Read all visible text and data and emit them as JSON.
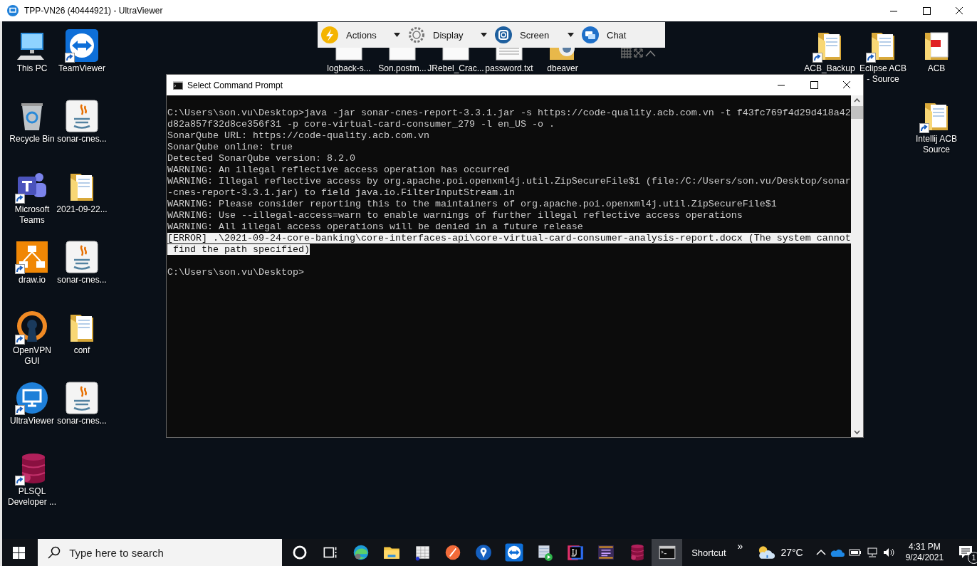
{
  "window": {
    "title": "TPP-VN26 (40444921) - UltraViewer"
  },
  "toolbar": {
    "items": [
      {
        "label": "Actions",
        "kind": "actions",
        "dropdown": true
      },
      {
        "label": "Display",
        "kind": "display",
        "dropdown": true
      },
      {
        "label": "Screen",
        "kind": "screen",
        "dropdown": true
      },
      {
        "label": "Chat",
        "kind": "chat",
        "dropdown": false
      }
    ]
  },
  "desktop": {
    "icons": [
      {
        "label": "This PC",
        "kind": "computer",
        "shortcut": false
      },
      {
        "label": "Recycle Bin",
        "kind": "recycle",
        "shortcut": false
      },
      {
        "label": "Microsoft Teams",
        "kind": "teams",
        "shortcut": true
      },
      {
        "label": "draw.io",
        "kind": "drawio",
        "shortcut": true
      },
      {
        "label": "OpenVPN GUI",
        "kind": "openvpn",
        "shortcut": true
      },
      {
        "label": "UltraViewer",
        "kind": "ultraviewer",
        "shortcut": true
      },
      {
        "label": "PLSQL Developer ...",
        "kind": "plsql",
        "shortcut": true
      },
      {
        "label": "TeamViewer",
        "kind": "teamviewer",
        "shortcut": true
      },
      {
        "label": "sonar-cnes...",
        "kind": "java",
        "shortcut": false
      },
      {
        "label": "2021-09-22...",
        "kind": "folder",
        "shortcut": false
      },
      {
        "label": "sonar-cnes...",
        "kind": "java",
        "shortcut": false
      },
      {
        "label": "conf",
        "kind": "folder",
        "shortcut": false
      },
      {
        "label": "sonar-cnes...",
        "kind": "java",
        "shortcut": false
      },
      {
        "label": "logback-s...",
        "kind": "file",
        "shortcut": false
      },
      {
        "label": "Son.postm...",
        "kind": "file",
        "shortcut": false
      },
      {
        "label": "JRebel_Crac...",
        "kind": "word",
        "shortcut": false
      },
      {
        "label": "password.txt",
        "kind": "text",
        "shortcut": false
      },
      {
        "label": "dbeaver",
        "kind": "dbeaver",
        "shortcut": false
      },
      {
        "label": "ACB_Backup",
        "kind": "folder",
        "shortcut": true
      },
      {
        "label": "Eclipse ACB - Source",
        "kind": "folder",
        "shortcut": true
      },
      {
        "label": "ACB",
        "kind": "pdffolder",
        "shortcut": false
      },
      {
        "label": "Intellij ACB Source",
        "kind": "folder",
        "shortcut": true
      }
    ]
  },
  "console": {
    "title": "Select Command Prompt",
    "lines": [
      {
        "text": "C:\\Users\\son.vu\\Desktop>java -jar sonar-cnes-report-3.3.1.jar -s https://code-quality.acb.com.vn -t f43fc769f4d29d418a42",
        "selected": false
      },
      {
        "text": "d82a857f32d8ce356f31 -p core-virtual-card-consumer_279 -l en_US -o .",
        "selected": false
      },
      {
        "text": "SonarQube URL: https://code-quality.acb.com.vn",
        "selected": false
      },
      {
        "text": "SonarQube online: true",
        "selected": false
      },
      {
        "text": "Detected SonarQube version: 8.2.0",
        "selected": false
      },
      {
        "text": "WARNING: An illegal reflective access operation has occurred",
        "selected": false
      },
      {
        "text": "WARNING: Illegal reflective access by org.apache.poi.openxml4j.util.ZipSecureFile$1 (file:/C:/Users/son.vu/Desktop/sonar",
        "selected": false
      },
      {
        "text": "-cnes-report-3.3.1.jar) to field java.io.FilterInputStream.in",
        "selected": false
      },
      {
        "text": "WARNING: Please consider reporting this to the maintainers of org.apache.poi.openxml4j.util.ZipSecureFile$1",
        "selected": false
      },
      {
        "text": "WARNING: Use --illegal-access=warn to enable warnings of further illegal reflective access operations",
        "selected": false
      },
      {
        "text": "WARNING: All illegal access operations will be denied in a future release",
        "selected": false
      },
      {
        "text": "[ERROR] .\\2021-09-24-core-banking\\core-interfaces-api\\core-virtual-card-consumer-analysis-report.docx (The system cannot",
        "selected": true
      },
      {
        "text": " find the path specified)",
        "selected": true
      }
    ],
    "prompt": "C:\\Users\\son.vu\\Desktop>"
  },
  "taskbar": {
    "search": {
      "placeholder": "Type here to search"
    },
    "apps": [
      {
        "kind": "cortana",
        "active": false
      },
      {
        "kind": "taskview",
        "active": false
      },
      {
        "kind": "edge",
        "active": false
      },
      {
        "kind": "explorer",
        "active": false
      },
      {
        "kind": "sql",
        "active": false
      },
      {
        "kind": "compass",
        "active": false
      },
      {
        "kind": "pin",
        "active": false
      },
      {
        "kind": "teamviewer",
        "active": false
      },
      {
        "kind": "media",
        "active": false
      },
      {
        "kind": "intellij",
        "active": false
      },
      {
        "kind": "javaee",
        "active": false
      },
      {
        "kind": "plsql",
        "active": false
      },
      {
        "kind": "cmd",
        "active": true
      }
    ],
    "toolbar_label": "Shortcut",
    "toolbar_more": "»",
    "temperature": "27°C",
    "time": "4:31 PM",
    "date": "9/24/2021",
    "notification_count": "1"
  }
}
